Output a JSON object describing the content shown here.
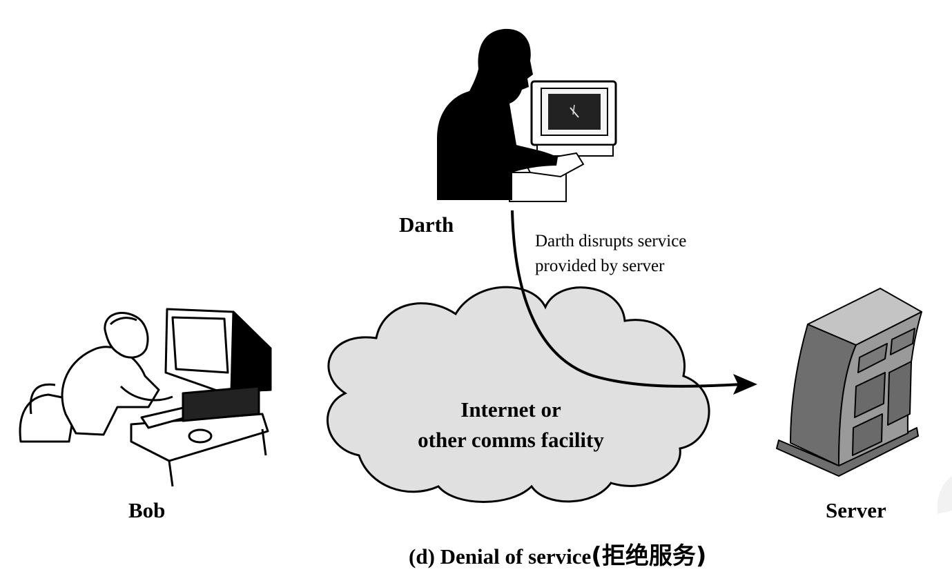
{
  "labels": {
    "darth": "Darth",
    "bob": "Bob",
    "server": "Server"
  },
  "annotation": {
    "line1": "Darth disrupts service",
    "line2": "provided by server"
  },
  "cloud": {
    "line1": "Internet or",
    "line2": "other comms facility"
  },
  "caption": {
    "en": "(d) Denial of service",
    "cn": "(拒绝服务)"
  },
  "icons": [
    "darth-silhouette-icon",
    "bob-computer-user-icon",
    "server-tower-icon",
    "network-cloud-icon",
    "attack-arrow-icon"
  ],
  "colors": {
    "cloud_fill": "#e0e0e0",
    "ink": "#000000",
    "server_body": "#9a9a9a",
    "server_side": "#6e6e6e",
    "server_top": "#c4c4c4"
  }
}
